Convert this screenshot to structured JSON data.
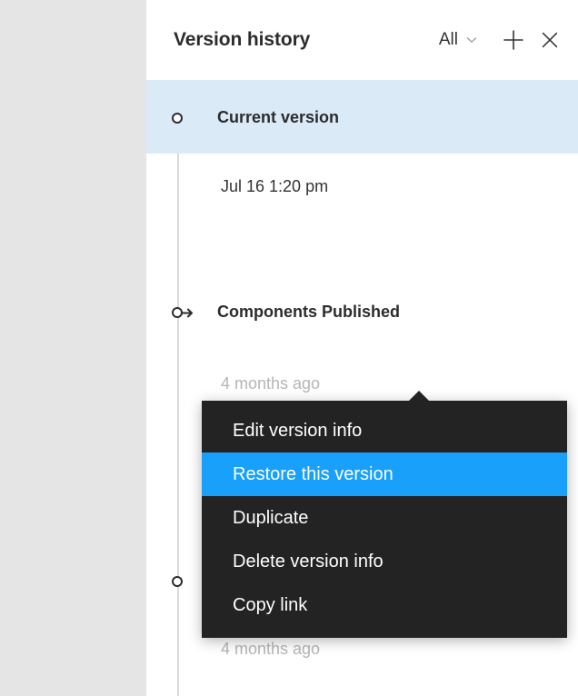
{
  "panel": {
    "title": "Version history",
    "filter": {
      "label": "All",
      "chevron_icon": "chevron-down-icon"
    },
    "add_icon": "plus-icon",
    "close_icon": "close-icon"
  },
  "timeline": {
    "entries": [
      {
        "title": "Current version",
        "subtitle": "Jul 16 1:20 pm",
        "marker": "circle-node-icon",
        "selected": true,
        "muted_subtitle": false
      },
      {
        "title": "Components Published",
        "subtitle": "4 months ago",
        "marker": "circle-arrow-published-icon",
        "selected": false,
        "muted_subtitle": true
      },
      {
        "title": "",
        "subtitle": "4 months ago",
        "marker": "circle-node-icon",
        "selected": false,
        "muted_subtitle": true
      }
    ]
  },
  "context_menu": {
    "items": [
      {
        "label": "Edit version info",
        "selected": false
      },
      {
        "label": "Restore this version",
        "selected": true
      },
      {
        "label": "Duplicate",
        "selected": false
      },
      {
        "label": "Delete version info",
        "selected": false
      },
      {
        "label": "Copy link",
        "selected": false
      }
    ]
  },
  "colors": {
    "accent": "#18a0fb",
    "selected_row": "#daeaf7",
    "menu_background": "#232323",
    "text_primary": "#2c2c2c",
    "text_muted": "#b5b5b5",
    "canvas": "#e5e5e5",
    "scrollbar_thumb": "#a1a1a1"
  }
}
